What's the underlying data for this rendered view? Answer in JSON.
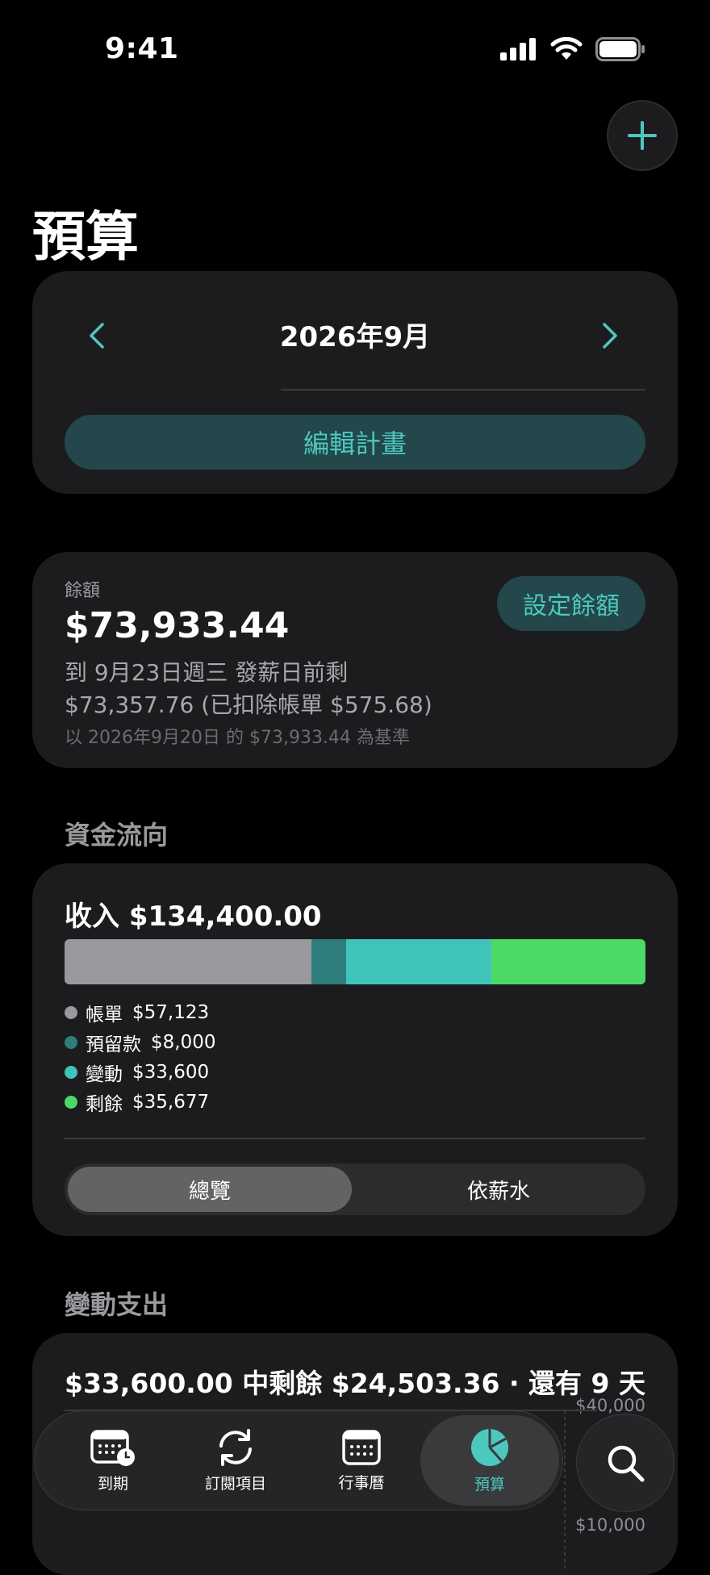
{
  "status_bar": {
    "time": "9:41"
  },
  "page": {
    "title": "預算"
  },
  "month_card": {
    "month": "2026年9月",
    "edit_plan": "編輯計畫"
  },
  "balance": {
    "label": "餘額",
    "amount": "$73,933.44",
    "set_button": "設定餘額",
    "line1": "到 9月23日週三 發薪日前剩",
    "line2": "$73,357.76 (已扣除帳單 $575.68)",
    "line3": "以 2026年9月20日 的 $73,933.44 為基準"
  },
  "cash_flow": {
    "heading": "資金流向",
    "income_label": "收入 $134,400.00",
    "segments": [
      {
        "name": "帳單",
        "value": "$57,123",
        "amount": 57123,
        "color": "#98989f"
      },
      {
        "name": "預留款",
        "value": "$8,000",
        "amount": 8000,
        "color": "#2e7f7b"
      },
      {
        "name": "變動",
        "value": "$33,600",
        "amount": 33600,
        "color": "#3ec4bb"
      },
      {
        "name": "剩餘",
        "value": "$35,677",
        "amount": 35677,
        "color": "#4cd964"
      }
    ],
    "segmented": {
      "overview": "總覽",
      "by_salary": "依薪水"
    }
  },
  "variable_spending": {
    "heading": "變動支出",
    "summary": "$33,600.00 中剩餘 $24,503.36 · 還有 9 天",
    "axis_top": "$40,000",
    "axis_bottom": "$10,000"
  },
  "tab_bar": {
    "tabs": [
      {
        "label": "到期",
        "icon": "calendar-clock-icon"
      },
      {
        "label": "訂閱項目",
        "icon": "refresh-icon"
      },
      {
        "label": "行事曆",
        "icon": "calendar-icon"
      },
      {
        "label": "預算",
        "icon": "pie-chart-icon"
      }
    ],
    "active": "預算"
  },
  "colors": {
    "accent": "#4dc8be",
    "card": "#1c1c1e",
    "background": "#000000"
  }
}
